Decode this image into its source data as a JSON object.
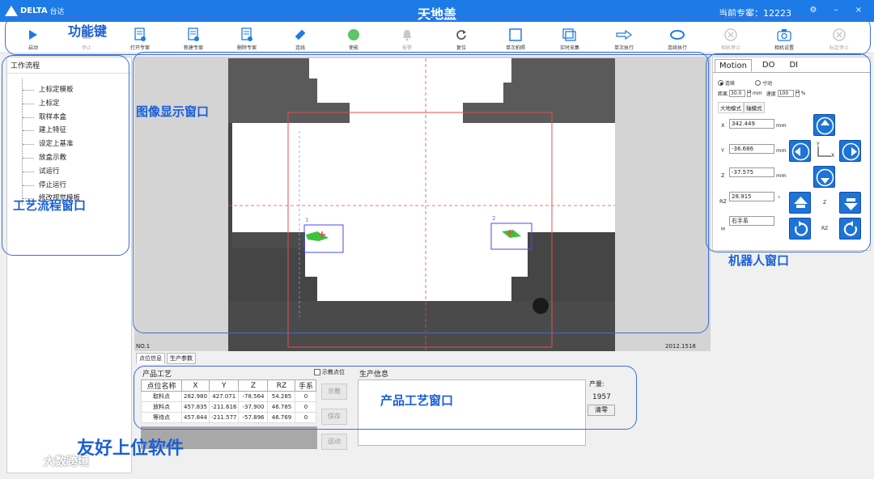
{
  "app": {
    "title": "天地盖",
    "logo_text": "DELTA",
    "logo_cn": "台达",
    "project_label": "当前专案：",
    "project_value": "12223",
    "window": {
      "settings_icon": "⚙",
      "minimize": "–",
      "close": "×"
    }
  },
  "toolbar": {
    "items": [
      {
        "label": "启动",
        "icon": "play-icon",
        "enabled": true
      },
      {
        "label": "停止",
        "icon": "stop-icon",
        "enabled": false
      },
      {
        "label": "打开专案",
        "icon": "open-project-icon",
        "enabled": true
      },
      {
        "label": "新建专案",
        "icon": "new-project-icon",
        "enabled": true
      },
      {
        "label": "删除专案",
        "icon": "delete-project-icon",
        "enabled": true
      },
      {
        "label": "连线",
        "icon": "connect-icon",
        "enabled": true
      },
      {
        "label": "使能",
        "icon": "enable-icon",
        "enabled": true
      },
      {
        "label": "报警",
        "icon": "alarm-bell-icon",
        "enabled": false
      },
      {
        "label": "复位",
        "icon": "reset-icon",
        "enabled": true
      },
      {
        "label": "单次拍照",
        "icon": "single-shot-icon",
        "enabled": true
      },
      {
        "label": "实时采集",
        "icon": "live-capture-icon",
        "enabled": true
      },
      {
        "label": "单次执行",
        "icon": "single-run-icon",
        "enabled": true
      },
      {
        "label": "连续执行",
        "icon": "continuous-run-icon",
        "enabled": true
      },
      {
        "label": "相机停止",
        "icon": "camera-stop-icon",
        "enabled": false
      },
      {
        "label": "相机设置",
        "icon": "camera-settings-icon",
        "enabled": true
      },
      {
        "label": "标定停止",
        "icon": "calib-stop-icon",
        "enabled": false
      }
    ],
    "enable_badge": "ON"
  },
  "annotations": {
    "function_keys": "功能键",
    "image_window": "图像显示窗口",
    "process_window": "工艺流程窗口",
    "robot_window": "机器人窗口",
    "product_window": "产品工艺窗口",
    "software": "友好上位软件",
    "watermark": "大数跨境"
  },
  "workflow": {
    "title": "工作流程",
    "items": [
      "上标定模板",
      "上标定",
      "取样本盒",
      "建上特征",
      "设定上基准",
      "放盒示教",
      "试运行",
      "停止运行",
      "修改视觉模板"
    ]
  },
  "image": {
    "no_label": "NO.1",
    "coord_readout": "2012.1518",
    "marker_1": "1",
    "marker_2": "2"
  },
  "bottom_tabs": [
    "点位信息",
    "生产参数"
  ],
  "product_process": {
    "title": "产品工艺",
    "demo_points_label": "示教点位",
    "columns": [
      "点位名称",
      "X",
      "Y",
      "Z",
      "RZ",
      "手系"
    ],
    "rows": [
      [
        "取料点",
        "282.980",
        "427.071",
        "-78.564",
        "54.285",
        "0"
      ],
      [
        "放料点",
        "457.835",
        "-211.616",
        "-37.900",
        "46.785",
        "0"
      ],
      [
        "等待点",
        "457.844",
        "-211.577",
        "-57.896",
        "46.769",
        "0"
      ]
    ],
    "buttons": {
      "teach": "示教",
      "save": "保存",
      "move": "运动"
    }
  },
  "production_info": {
    "title": "生产信息",
    "yield_label": "产量:",
    "yield_value": "1957",
    "clear": "清零"
  },
  "robot": {
    "tabs": [
      "Motion",
      "DO",
      "DI"
    ],
    "continuous_label": "连续",
    "inch_label": "寸动",
    "distance_label": "距离",
    "distance_value": "30.0",
    "distance_unit": "mm",
    "speed_label": "速度",
    "speed_value": "100",
    "speed_unit": "%",
    "modes": [
      "大地模式",
      "轴模式"
    ],
    "x_label": "X",
    "x_value": "342.449",
    "y_label": "Y",
    "y_value": "-36.686",
    "z_label": "Z",
    "z_value": "-37.575",
    "rz_label": "RZ",
    "rz_value": "28.915",
    "rz_unit": "°",
    "h_label": "H",
    "h_value": "右手系",
    "unit": "mm",
    "jog_axis_y": "Y",
    "jog_axis_x": "X",
    "jog_z": "Z",
    "jog_rz": "RZ"
  },
  "colors": {
    "accent": "#1d7be8",
    "annotation": "#1a5fd8",
    "jog": "#1e73d6"
  }
}
